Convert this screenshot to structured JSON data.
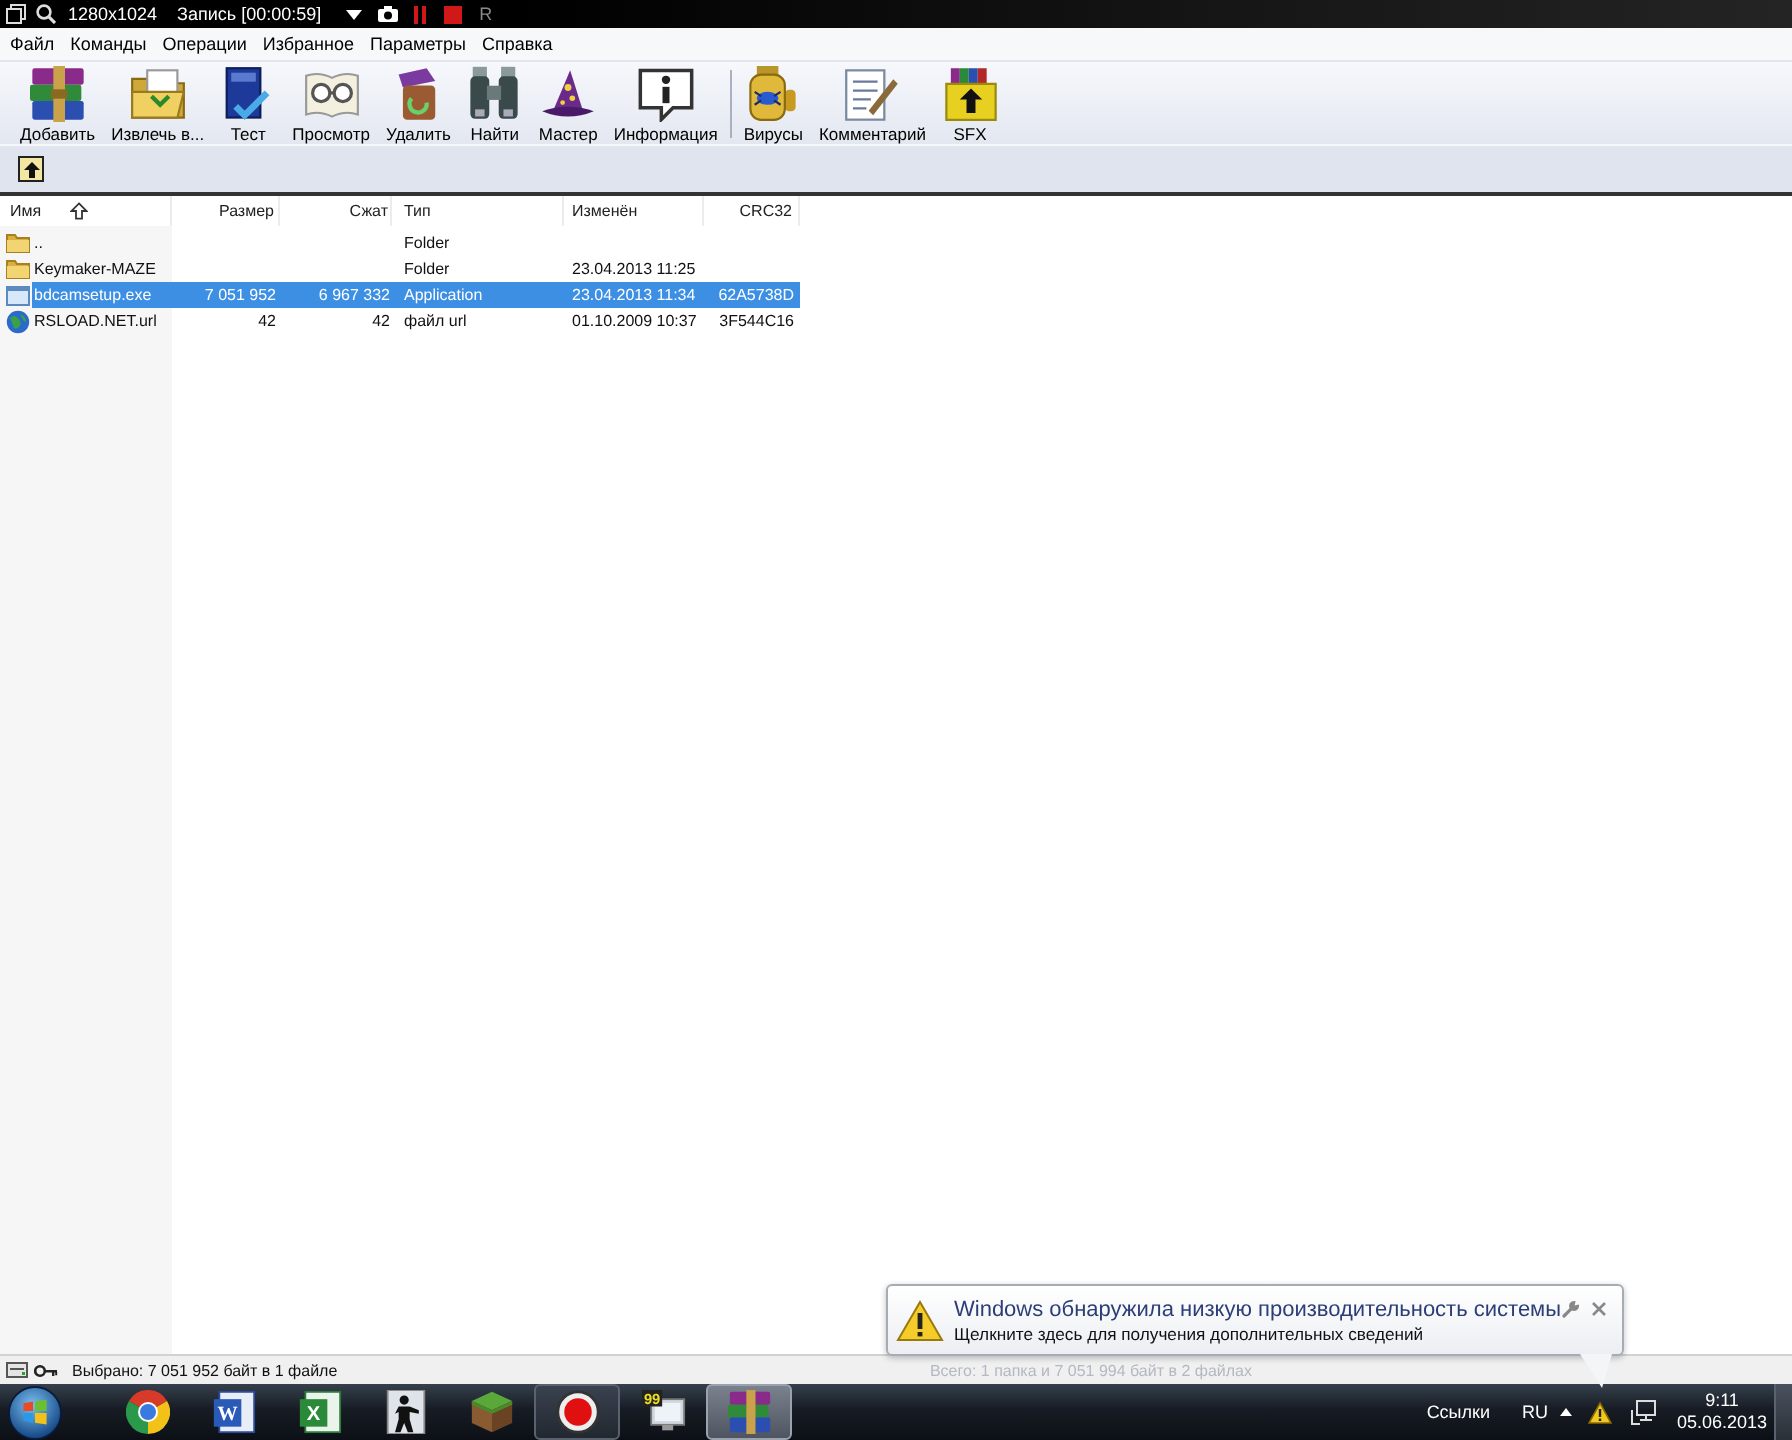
{
  "recorder_bar": {
    "resolution": "1280x1024",
    "status": "Запись [00:00:59]",
    "title_fragment": "R"
  },
  "menu": [
    "Файл",
    "Команды",
    "Операции",
    "Избранное",
    "Параметры",
    "Справка"
  ],
  "toolbar": {
    "groups": [
      {
        "buttons": [
          "Добавить",
          "Извлечь в...",
          "Тест",
          "Просмотр",
          "Удалить",
          "Найти",
          "Мастер",
          "Информация"
        ]
      },
      {
        "buttons": [
          "Вирусы",
          "Комментарий",
          "SFX"
        ]
      }
    ]
  },
  "file_list": {
    "columns": [
      {
        "label": "Имя",
        "sorted": true
      },
      {
        "label": "Размер",
        "sorted": false
      },
      {
        "label": "Сжат",
        "sorted": false
      },
      {
        "label": "Тип",
        "sorted": false
      },
      {
        "label": "Изменён",
        "sorted": false
      },
      {
        "label": "CRC32",
        "sorted": false
      }
    ],
    "rows": [
      {
        "kind": "folder",
        "name": "..",
        "type": "Folder",
        "selected": false
      },
      {
        "kind": "folder",
        "name": "Keymaker-MAZE",
        "type": "Folder",
        "modified": "23.04.2013 11:25",
        "selected": false
      },
      {
        "kind": "application",
        "name": "bdcamsetup.exe",
        "size": "7 051 952",
        "packed": "6 967 332",
        "type": "Application",
        "modified": "23.04.2013 11:34",
        "crc": "62A5738D",
        "selected": true
      },
      {
        "kind": "url",
        "name": "RSLOAD.NET.url",
        "size": "42",
        "packed": "42",
        "type": "файл url",
        "modified": "01.10.2009 10:37",
        "crc": "3F544C16",
        "selected": false
      }
    ]
  },
  "status_bar": {
    "selection": "Выбрано: 7 051 952 байт в 1 файле",
    "total": "Всего: 1 папка и 7 051 994 байт в 2 файлах"
  },
  "notification": {
    "title": "Windows обнаружила низкую производительность системы",
    "text": "Щелкните здесь для получения дополнительных сведений"
  },
  "taskbar": {
    "buttons": [
      {
        "running": false,
        "selected": false
      },
      {
        "running": false,
        "selected": false,
        "glyph": "W"
      },
      {
        "running": false,
        "selected": false,
        "glyph": "X"
      },
      {
        "running": false,
        "selected": false
      },
      {
        "running": false,
        "selected": false
      },
      {
        "running": true,
        "selected": false
      },
      {
        "running": false,
        "selected": false,
        "glyph": "99"
      },
      {
        "running": true,
        "selected": true
      }
    ]
  },
  "tray": {
    "links": "Ссылки",
    "language": "RU",
    "time": "9:11",
    "date": "05.06.2013"
  }
}
